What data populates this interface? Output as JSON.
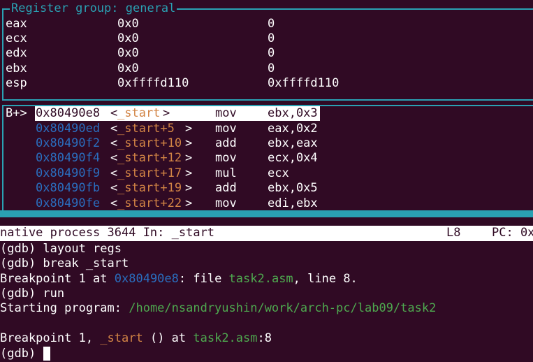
{
  "registers": {
    "title": "Register group: general",
    "rows": [
      {
        "name": "eax",
        "hex": "0x0",
        "val": "0"
      },
      {
        "name": "ecx",
        "hex": "0x0",
        "val": "0"
      },
      {
        "name": "edx",
        "hex": "0x0",
        "val": "0"
      },
      {
        "name": "ebx",
        "hex": "0x0",
        "val": "0"
      },
      {
        "name": "esp",
        "hex": "0xffffd110",
        "val": "0xffffd110"
      }
    ]
  },
  "asm": {
    "marker": "B+>",
    "rows": [
      {
        "addr": "0x80490e8",
        "lt": "<",
        "sym": "_start",
        "gt": ">",
        "op": "mov",
        "args": "ebx,0x3"
      },
      {
        "addr": "0x80490ed",
        "lt": "<",
        "sym": "_start+5",
        "gt": ">",
        "op": "mov",
        "args": "eax,0x2"
      },
      {
        "addr": "0x80490f2",
        "lt": "<",
        "sym": "_start+10",
        "gt": ">",
        "op": "add",
        "args": "ebx,eax"
      },
      {
        "addr": "0x80490f4",
        "lt": "<",
        "sym": "_start+12",
        "gt": ">",
        "op": "mov",
        "args": "ecx,0x4"
      },
      {
        "addr": "0x80490f9",
        "lt": "<",
        "sym": "_start+17",
        "gt": ">",
        "op": "mul",
        "args": "ecx"
      },
      {
        "addr": "0x80490fb",
        "lt": "<",
        "sym": "_start+19",
        "gt": ">",
        "op": "add",
        "args": "ebx,0x5"
      },
      {
        "addr": "0x80490fe",
        "lt": "<",
        "sym": "_start+22",
        "gt": ">",
        "op": "mov",
        "args": "edi,ebx"
      }
    ]
  },
  "status": {
    "left": "native process 3644 In: _start",
    "line": "L8",
    "pc": "PC: 0x"
  },
  "console": {
    "l1": "(gdb) layout regs",
    "l2": "(gdb) break _start",
    "l3a": "Breakpoint 1 at ",
    "l3b": "0x80490e8",
    "l3c": ": file ",
    "l3d": "task2.asm",
    "l3e": ", line 8.",
    "l4": "(gdb) run",
    "l5a": "Starting program: ",
    "l5b": "/home/nsandryushin/work/arch-pc/lab09/task2",
    "l6a": "Breakpoint 1, ",
    "l6b": "_start",
    "l6c": " () at ",
    "l6d": "task2.asm",
    "l6e": ":8",
    "prompt": "(gdb) "
  },
  "colors": {
    "background": "#300a24",
    "border": "#2aa1b3",
    "address": "#2a6ebf",
    "symbol": "#d28445",
    "filename": "#4ea94f"
  }
}
